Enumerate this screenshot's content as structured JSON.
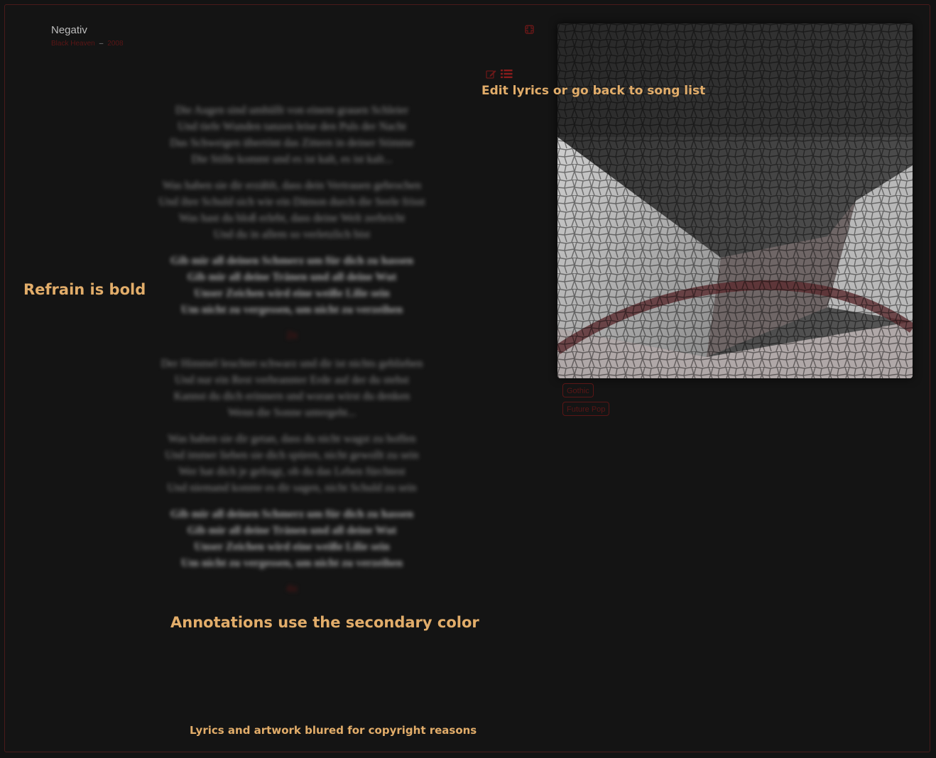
{
  "song": {
    "title": "Negativ",
    "album": "Black Heaven",
    "separator": "–",
    "year": "2008"
  },
  "icons": {
    "collapse": "collapse-icon",
    "edit": "edit-icon",
    "list": "list-icon"
  },
  "annotations": {
    "edit_hint": "Edit lyrics or go back to song list",
    "refrain_hint": "Refrain is bold",
    "secondary_color_hint": "Annotations use the secondary color",
    "copyright_hint": "Lyrics and artwork blured for copyright reasons"
  },
  "lyrics": {
    "stanza_1": [
      "Die Augen sind umhüllt von einem grauen Schleier",
      "Und tiefe Wunden tanzen leise den Puls der Nacht",
      "Das Schweigen übertönt das Zittern in deiner Stimme",
      "Die Stille kommt und es ist kalt, es ist kalt..."
    ],
    "stanza_2": [
      "Was haben sie dir erzählt, dass dein Vertrauen gebrochen",
      "Und ihre Schuld sich wie ein Dämon durch die Seele frisst",
      "Was hast du bloß erlebt, dass deine Welt zerbricht",
      "Und du in allem so verletzlich bist"
    ],
    "refrain_1": [
      "Gib mir all deinen Schmerz um für dich zu hassen",
      "Gib mir all deine Tränen und all deine Wut",
      "Unser Zeichen wird eine weiße Lilie sein",
      "Um nicht zu vergessen, um nicht zu verzeihen"
    ],
    "repeat_1": "2x",
    "stanza_3": [
      "Der Himmel leuchtet schwarz und dir ist nichts geblieben",
      "Und nur ein Rest verbrannter Erde auf der du stehst",
      "Kannst du dich erinnern und woran wirst du denken",
      "Wenn die Sonne untergeht..."
    ],
    "stanza_4": [
      "Was haben sie dir getan, dass du nicht wagst zu hoffen",
      "Und immer lieben sie dich spüren, nicht gewollt zu sein",
      "Wer hat dich je gefragt, ob du das Leben fürchtest",
      "Und niemand konnte es dir sagen, nicht Schuld zu sein"
    ],
    "refrain_2": [
      "Gib mir all deinen Schmerz um für dich zu hassen",
      "Gib mir all deine Tränen und all deine Wut",
      "Unser Zeichen wird eine weiße Lilie sein",
      "Um nicht zu vergessen, um nicht zu verzeihen"
    ],
    "repeat_2": "4x"
  },
  "tags": [
    "Gothic",
    "Future Pop"
  ],
  "colors": {
    "background": "#131313",
    "primary_text": "#bdbdbd",
    "secondary": "#5a1616",
    "annotation_overlay": "#e2ad6a"
  }
}
